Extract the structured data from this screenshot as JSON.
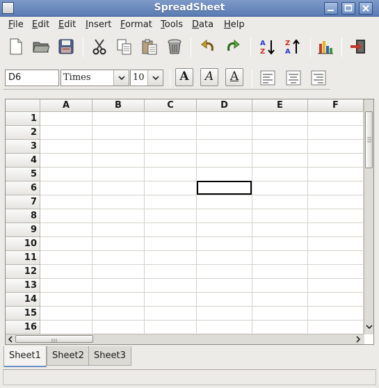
{
  "window": {
    "title": "SpreadSheet"
  },
  "menu": [
    {
      "accel": "F",
      "rest": "ile"
    },
    {
      "accel": "E",
      "rest": "dit"
    },
    {
      "accel": "E",
      "rest": "dit"
    },
    {
      "accel": "I",
      "rest": "nsert"
    },
    {
      "accel": "F",
      "rest": "ormat"
    },
    {
      "accel": "T",
      "rest": "ools"
    },
    {
      "accel": "D",
      "rest": "ata"
    },
    {
      "accel": "H",
      "rest": "elp"
    }
  ],
  "toolbar_icons": [
    "new-icon",
    "open-icon",
    "save-icon",
    "cut-icon",
    "copy-icon",
    "paste-icon",
    "delete-icon",
    "undo-icon",
    "redo-icon",
    "sort-ascending-icon",
    "sort-descending-icon",
    "chart-icon",
    "exit-icon"
  ],
  "format_bar": {
    "cell_ref": "D6",
    "font_name": "Times",
    "font_size": "10",
    "bold_label": "A",
    "italic_label": "A",
    "underline_label": "A"
  },
  "grid": {
    "columns": [
      "A",
      "B",
      "C",
      "D",
      "E",
      "F"
    ],
    "rows": [
      "1",
      "2",
      "3",
      "4",
      "5",
      "6",
      "7",
      "8",
      "9",
      "10",
      "11",
      "12",
      "13",
      "14",
      "15",
      "16"
    ],
    "selected_cell": "D6"
  },
  "sheets": [
    "Sheet1",
    "Sheet2",
    "Sheet3"
  ],
  "active_sheet": "Sheet1",
  "scroll_arrows": {
    "up": "▲",
    "down": "▼",
    "left": "<",
    "right": ">"
  }
}
